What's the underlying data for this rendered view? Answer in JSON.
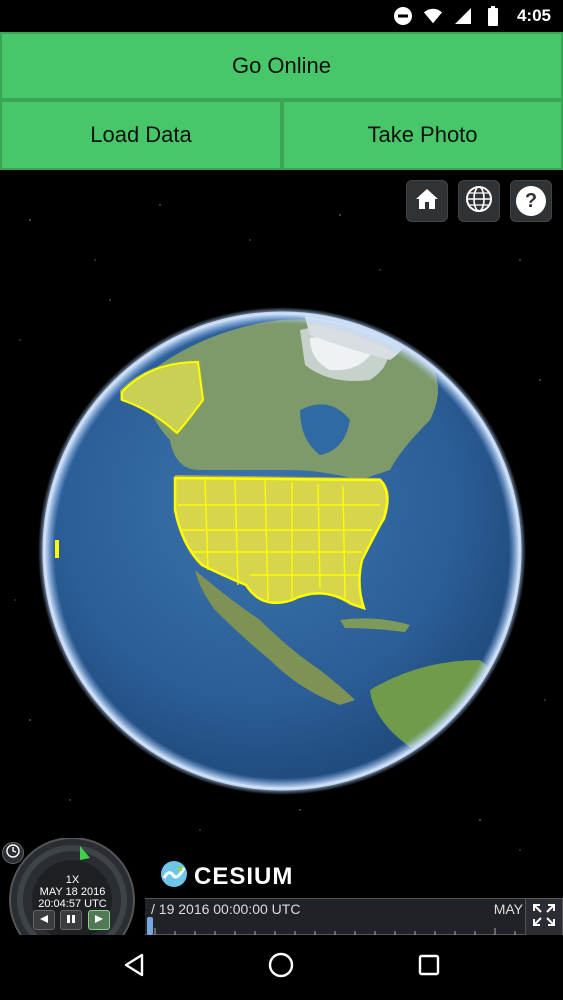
{
  "status_bar": {
    "time": "4:05",
    "icons": [
      "do-not-disturb-icon",
      "wifi-icon",
      "signal-icon",
      "battery-icon"
    ]
  },
  "buttons": {
    "go_online": "Go Online",
    "load_data": "Load Data",
    "take_photo": "Take Photo"
  },
  "toolbar": {
    "items": [
      "home-icon",
      "globe-icon",
      "help-icon"
    ],
    "help_glyph": "?"
  },
  "animation": {
    "speed": "1X",
    "date": "MAY 18 2016",
    "time": "20:04:57 UTC"
  },
  "logo": {
    "text": "CESIUM"
  },
  "timeline": {
    "start_label": "/ 19 2016 00:00:00 UTC",
    "end_label": "MAY"
  },
  "colors": {
    "button_green": "#47c76a",
    "highlight_yellow": "#ffff00",
    "space": "#000000",
    "ocean": "#2f5f9a"
  },
  "navigation": {
    "items": [
      "back-icon",
      "home-circle-icon",
      "recents-icon"
    ]
  }
}
